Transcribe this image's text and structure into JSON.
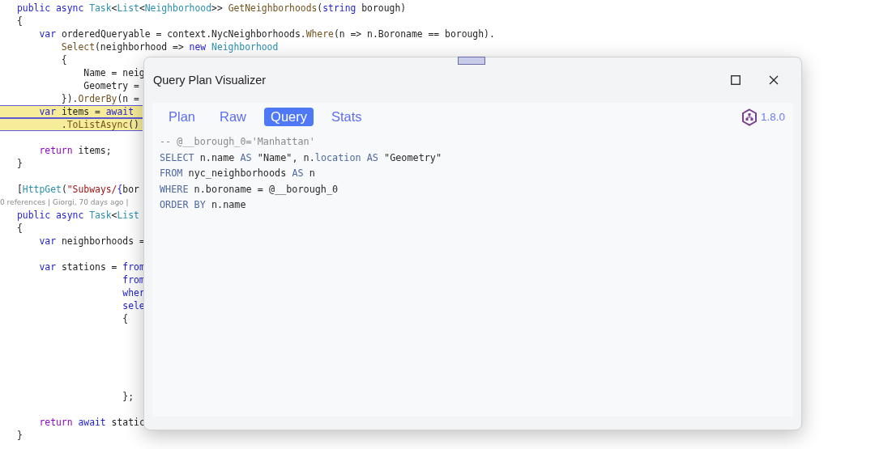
{
  "editor": {
    "lines": [
      {
        "kind": "code",
        "highlighted": false,
        "tokens": [
          {
            "text": "public async ",
            "kind": "kw"
          },
          {
            "text": "Task",
            "kind": "type"
          },
          {
            "text": "<",
            "kind": "plain"
          },
          {
            "text": "List",
            "kind": "type"
          },
          {
            "text": "<",
            "kind": "plain"
          },
          {
            "text": "Neighborhood",
            "kind": "type"
          },
          {
            "text": ">> ",
            "kind": "plain"
          },
          {
            "text": "GetNeighborhoods",
            "kind": "method"
          },
          {
            "text": "(",
            "kind": "plain"
          },
          {
            "text": "string",
            "kind": "kw"
          },
          {
            "text": " borough)",
            "kind": "plain"
          }
        ]
      },
      {
        "kind": "code",
        "highlighted": false,
        "tokens": [
          {
            "text": "{",
            "kind": "plain"
          }
        ]
      },
      {
        "kind": "code",
        "highlighted": false,
        "tokens": [
          {
            "text": "    var ",
            "kind": "kw"
          },
          {
            "text": "orderedQueryable = context.NycNeighborhoods.",
            "kind": "plain"
          },
          {
            "text": "Where",
            "kind": "method"
          },
          {
            "text": "(n => n.Boroname == borough).",
            "kind": "plain"
          }
        ]
      },
      {
        "kind": "code",
        "highlighted": false,
        "tokens": [
          {
            "text": "        Select",
            "kind": "method"
          },
          {
            "text": "(neighborhood => ",
            "kind": "plain"
          },
          {
            "text": "new ",
            "kind": "kw"
          },
          {
            "text": "Neighborhood",
            "kind": "type"
          }
        ]
      },
      {
        "kind": "code",
        "highlighted": false,
        "tokens": [
          {
            "text": "        {",
            "kind": "plain"
          }
        ]
      },
      {
        "kind": "code",
        "highlighted": false,
        "tokens": [
          {
            "text": "            Name = neig",
            "kind": "plain"
          }
        ]
      },
      {
        "kind": "code",
        "highlighted": false,
        "tokens": [
          {
            "text": "            Geometry =",
            "kind": "plain"
          }
        ]
      },
      {
        "kind": "code",
        "highlighted": false,
        "tokens": [
          {
            "text": "        }).",
            "kind": "plain"
          },
          {
            "text": "OrderBy",
            "kind": "method"
          },
          {
            "text": "(n =",
            "kind": "plain"
          }
        ]
      },
      {
        "kind": "code",
        "highlighted": true,
        "tokens": [
          {
            "text": "    var ",
            "kind": "kw"
          },
          {
            "text": "items = ",
            "kind": "plain"
          },
          {
            "text": "await",
            "kind": "kw"
          }
        ]
      },
      {
        "kind": "code",
        "highlighted": true,
        "tokens": [
          {
            "text": "        .",
            "kind": "plain"
          },
          {
            "text": "ToListAsync",
            "kind": "method"
          },
          {
            "text": "()",
            "kind": "plain"
          }
        ]
      },
      {
        "kind": "blank"
      },
      {
        "kind": "code",
        "highlighted": false,
        "tokens": [
          {
            "text": "    return ",
            "kind": "ctl"
          },
          {
            "text": "items;",
            "kind": "plain"
          }
        ]
      },
      {
        "kind": "code",
        "highlighted": false,
        "tokens": [
          {
            "text": "}",
            "kind": "plain"
          }
        ]
      },
      {
        "kind": "blank"
      },
      {
        "kind": "code",
        "highlighted": false,
        "tokens": [
          {
            "text": "[",
            "kind": "plain"
          },
          {
            "text": "HttpGet",
            "kind": "type"
          },
          {
            "text": "(",
            "kind": "plain"
          },
          {
            "text": "\"Subways/",
            "kind": "str"
          },
          {
            "text": "{",
            "kind": "kw"
          },
          {
            "text": "bor",
            "kind": "plain"
          }
        ]
      },
      {
        "kind": "codelens",
        "text": "0 references | Giorgi, 70 days ago |"
      },
      {
        "kind": "code",
        "highlighted": false,
        "tokens": [
          {
            "text": "public async ",
            "kind": "kw"
          },
          {
            "text": "Task",
            "kind": "type"
          },
          {
            "text": "<",
            "kind": "plain"
          },
          {
            "text": "List",
            "kind": "type"
          }
        ]
      },
      {
        "kind": "code",
        "highlighted": false,
        "tokens": [
          {
            "text": "{",
            "kind": "plain"
          }
        ]
      },
      {
        "kind": "code",
        "highlighted": false,
        "tokens": [
          {
            "text": "    var ",
            "kind": "kw"
          },
          {
            "text": "neighborhoods =",
            "kind": "plain"
          }
        ]
      },
      {
        "kind": "blank"
      },
      {
        "kind": "code",
        "highlighted": false,
        "tokens": [
          {
            "text": "    var ",
            "kind": "kw"
          },
          {
            "text": "stations = ",
            "kind": "plain"
          },
          {
            "text": "from",
            "kind": "kw"
          }
        ]
      },
      {
        "kind": "code",
        "highlighted": false,
        "tokens": [
          {
            "text": "                   from",
            "kind": "kw"
          }
        ]
      },
      {
        "kind": "code",
        "highlighted": false,
        "tokens": [
          {
            "text": "                   wher",
            "kind": "kw"
          }
        ]
      },
      {
        "kind": "code",
        "highlighted": false,
        "tokens": [
          {
            "text": "                   sele",
            "kind": "kw"
          }
        ]
      },
      {
        "kind": "code",
        "highlighted": false,
        "tokens": [
          {
            "text": "                   {",
            "kind": "plain"
          }
        ]
      },
      {
        "kind": "blank"
      },
      {
        "kind": "blank"
      },
      {
        "kind": "blank"
      },
      {
        "kind": "blank"
      },
      {
        "kind": "blank"
      },
      {
        "kind": "code",
        "highlighted": false,
        "tokens": [
          {
            "text": "                   };",
            "kind": "plain"
          }
        ]
      },
      {
        "kind": "blank"
      },
      {
        "kind": "code",
        "highlighted": false,
        "tokens": [
          {
            "text": "    return ",
            "kind": "ctl"
          },
          {
            "text": "await ",
            "kind": "kw"
          },
          {
            "text": "static",
            "kind": "plain"
          }
        ]
      },
      {
        "kind": "code",
        "highlighted": false,
        "tokens": [
          {
            "text": "}",
            "kind": "plain"
          }
        ]
      }
    ]
  },
  "dialog": {
    "title": "Query Plan Visualizer",
    "tabs": [
      {
        "label": "Plan",
        "selected": false
      },
      {
        "label": "Raw",
        "selected": false
      },
      {
        "label": "Query",
        "selected": true
      },
      {
        "label": "Stats",
        "selected": false
      }
    ],
    "version": "1.8.0",
    "query_lines": [
      [
        {
          "text": "-- @__borough_0='Manhattan'",
          "kind": "comment"
        }
      ],
      [
        {
          "text": "SELECT",
          "kind": "kw"
        },
        {
          "text": " n.name ",
          "kind": "plain"
        },
        {
          "text": "AS",
          "kind": "kw"
        },
        {
          "text": " \"Name\", n.",
          "kind": "plain"
        },
        {
          "text": "location AS",
          "kind": "kw"
        },
        {
          "text": " \"Geometry\"",
          "kind": "plain"
        }
      ],
      [
        {
          "text": "FROM",
          "kind": "kw"
        },
        {
          "text": " nyc_neighborhoods ",
          "kind": "plain"
        },
        {
          "text": "AS",
          "kind": "kw"
        },
        {
          "text": " n",
          "kind": "plain"
        }
      ],
      [
        {
          "text": "WHERE",
          "kind": "kw"
        },
        {
          "text": " n.boroname = @__borough_0",
          "kind": "plain"
        }
      ],
      [
        {
          "text": "ORDER BY",
          "kind": "kw"
        },
        {
          "text": " n.name",
          "kind": "plain"
        }
      ]
    ]
  }
}
